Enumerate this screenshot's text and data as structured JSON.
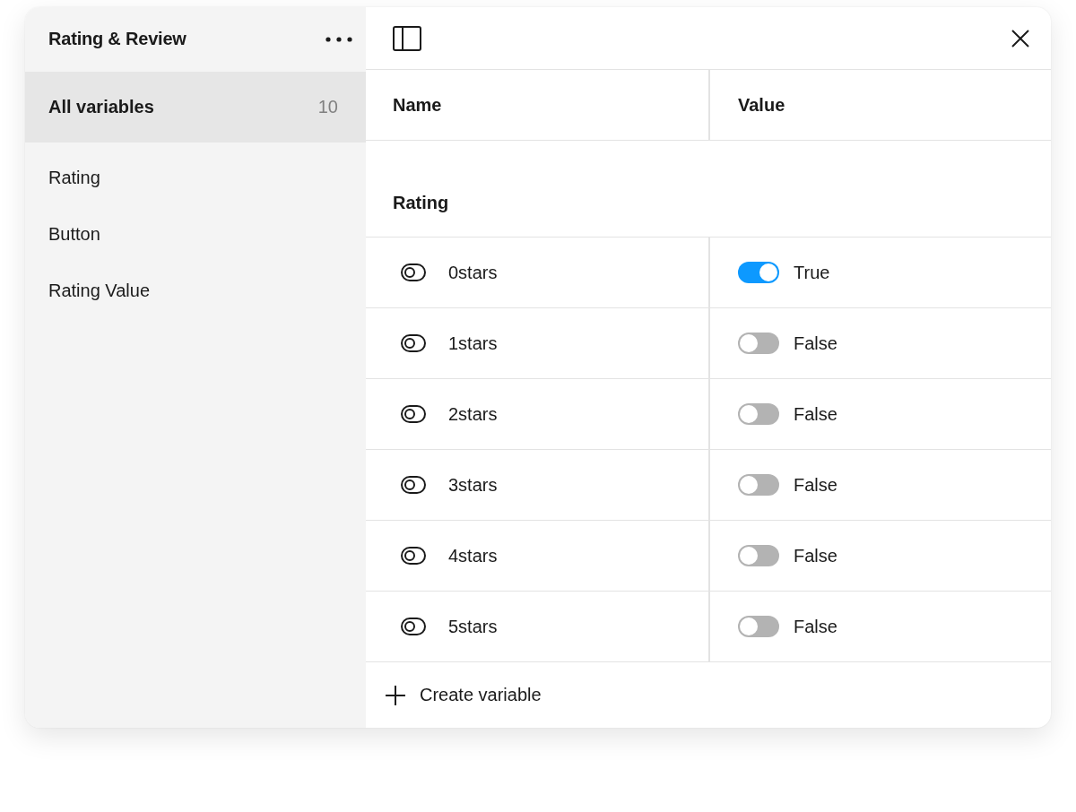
{
  "window": {
    "title": "Rating & Review"
  },
  "sidebar": {
    "items": [
      {
        "label": "All variables",
        "count": "10",
        "selected": true
      },
      {
        "label": "Rating",
        "selected": false
      },
      {
        "label": "Button",
        "selected": false
      },
      {
        "label": "Rating Value",
        "selected": false
      }
    ]
  },
  "table": {
    "columns": [
      "Name",
      "Value"
    ],
    "groups": [
      {
        "title": "Rating",
        "rows": [
          {
            "name": "0stars",
            "value": "True",
            "on": true
          },
          {
            "name": "1stars",
            "value": "False",
            "on": false
          },
          {
            "name": "2stars",
            "value": "False",
            "on": false
          },
          {
            "name": "3stars",
            "value": "False",
            "on": false
          },
          {
            "name": "4stars",
            "value": "False",
            "on": false
          },
          {
            "name": "5stars",
            "value": "False",
            "on": false
          }
        ]
      }
    ]
  },
  "footer": {
    "button": "Create variable"
  }
}
